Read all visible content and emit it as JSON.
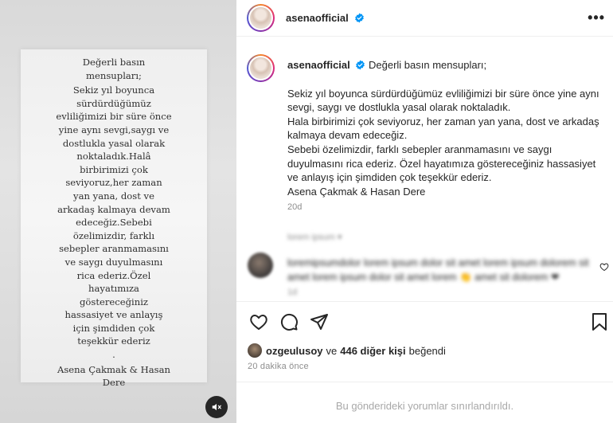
{
  "media": {
    "lines": [
      "Değerli basın",
      "mensupları;",
      "Sekiz yıl boyunca",
      "sürdürdüğümüz",
      "evliliğimizi bir süre önce",
      "yine aynı sevgi,saygı ve",
      "dostlukla yasal olarak",
      "noktaladık.Halâ",
      "birbirimizi çok",
      "seviyoruz,her zaman",
      "yan yana, dost ve",
      "arkadaş kalmaya devam",
      "edeceğiz.Sebebi",
      "özelimizdir, farklı",
      "sebepler aranmamasını",
      "ve saygı duyulmasını",
      "rica ederiz.Özel",
      "hayatımıza",
      "göstereceğiniz",
      "hassasiyet ve anlayış",
      "için şimdiden çok",
      "teşekkür  ederiz",
      ".",
      "Asena Çakmak & Hasan",
      "Dere"
    ],
    "mute_icon": "speaker-muted-icon"
  },
  "header": {
    "username": "asenaofficial",
    "verified_icon": "verified-badge-icon",
    "more_icon": "more-options-icon",
    "more_label": "•••"
  },
  "caption": {
    "username": "asenaofficial",
    "greeting": "Değerli basın mensupları;",
    "paragraphs": [
      "Sekiz yıl boyunca sürdürdüğümüz evliliğimizi bir süre önce yine aynı sevgi, saygı ve dostlukla yasal olarak noktaladık.",
      "Hala birbirimizi çok seviyoruz, her zaman yan yana, dost ve arkadaş kalmaya devam edeceğiz.",
      "Sebebi özelimizdir, farklı sebepler aranmamasını ve saygı duyulmasını rica ederiz. Özel hayatımıza göstereceğiniz hassasiyet ve anlayış için şimdiden çok teşekkür ederiz.",
      "Asena Çakmak & Hasan Dere"
    ],
    "age": "20d"
  },
  "blurred": {
    "line1": "lorem ipsum ▾",
    "comment": "loremipsumdolor lorem ipsum dolor sit amet lorem ipsum dolorem sit amet lorem ipsum dolor sit amet lorem 👏 amet sit dolorem ❤",
    "comment_time": "1d"
  },
  "actions": {
    "like_icon": "heart-icon",
    "comment_icon": "comment-icon",
    "share_icon": "paper-plane-icon",
    "save_icon": "bookmark-icon"
  },
  "likes": {
    "user": "ozgeulusoy",
    "connector": "ve",
    "others": "446 diğer kişi",
    "suffix": "beğendi"
  },
  "posted": "20 dakika önce",
  "comments_limited": "Bu gönderideki yorumlar sınırlandırıldı.",
  "colors": {
    "verified": "#0095f6",
    "text": "#262626",
    "secondary": "#8e8e8e"
  }
}
